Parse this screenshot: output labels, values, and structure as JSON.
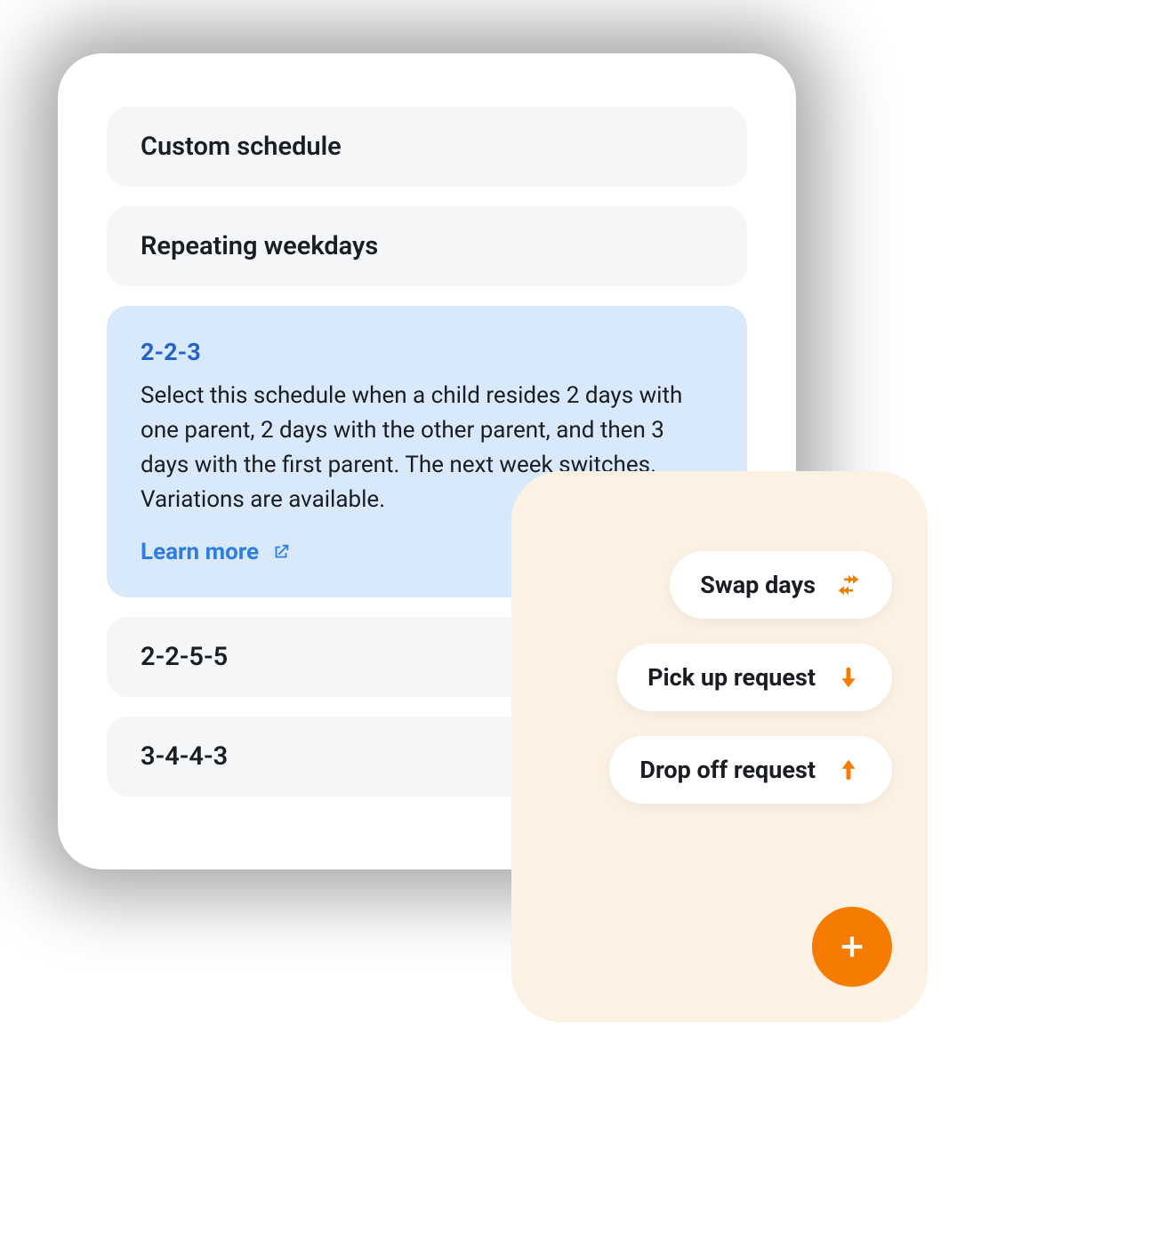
{
  "schedules": {
    "custom": {
      "label": "Custom schedule"
    },
    "repeating": {
      "label": "Repeating weekdays"
    },
    "s223": {
      "label": "2-2-3",
      "description": "Select this schedule when a child resides 2 days with one parent, 2 days with the other parent, and then 3 days with the first parent. The next week switches. Variations are available.",
      "learn_more": "Learn more"
    },
    "s2255": {
      "label": "2-2-5-5"
    },
    "s3443": {
      "label": "3-4-4-3"
    }
  },
  "actions": {
    "swap": {
      "label": "Swap days"
    },
    "pickup": {
      "label": "Pick up request"
    },
    "dropoff": {
      "label": "Drop off request"
    }
  }
}
